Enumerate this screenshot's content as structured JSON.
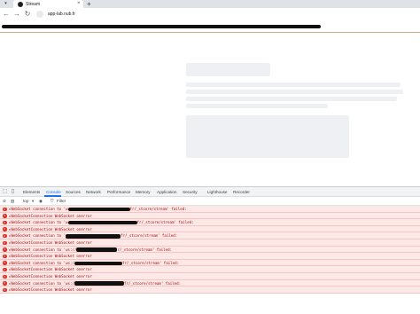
{
  "browser": {
    "tab_title": "Stream",
    "url": "app-lab.nub.fr",
    "new_tab_glyph": "+",
    "close_glyph": "×"
  },
  "devtools": {
    "tabs": [
      "Elements",
      "Console",
      "Sources",
      "Network",
      "Performance",
      "Memory",
      "Application",
      "Security",
      "Lighthouse",
      "Recorder"
    ],
    "active_tab": "Console",
    "console_toolbar": {
      "context": "top",
      "filter_placeholder": "Filter"
    },
    "messages": [
      {
        "prefix": "▸WebSocket connection to 'w",
        "suffix": "fr/_stcore/stream' failed:",
        "redact": 70
      },
      {
        "prefix": "▸WebSocketConnection WebSocket onerror",
        "suffix": "",
        "redact": 0
      },
      {
        "prefix": "▸WebSocket connection to 'w",
        "suffix": "fr/_stcore/stream' failed:",
        "redact": 78
      },
      {
        "prefix": "▸WebSocketConnection WebSocket onerror",
        "suffix": "",
        "redact": 0
      },
      {
        "prefix": "▸WebSocket connection to '",
        "suffix": "fr/_stcore/stream' failed:",
        "redact": 62
      },
      {
        "prefix": "▸WebSocketConnection WebSocket onerror",
        "suffix": "",
        "redact": 0
      },
      {
        "prefix": "▸WebSocket connection to 'ws://",
        "suffix": "r/_stcore/stream' failed:",
        "redact": 46
      },
      {
        "prefix": "▸WebSocketConnection WebSocket onerror",
        "suffix": "",
        "redact": 0
      },
      {
        "prefix": "▸WebSocket connection to 'ws:/",
        "suffix": "fr/_stcore/stream' failed:",
        "redact": 54
      },
      {
        "prefix": "▸WebSocketConnection WebSocket onerror",
        "suffix": "",
        "redact": 0
      },
      {
        "prefix": "▸WebSocketConnection WebSocket onerror",
        "suffix": "",
        "redact": 0
      },
      {
        "prefix": "▸WebSocket connection to 'ws:/",
        "suffix": "fr/_stcore/stream' failed:",
        "redact": 56
      },
      {
        "prefix": "▸WebSocketConnection WebSocket onerror",
        "suffix": "",
        "redact": 0
      }
    ],
    "prompt": ">"
  },
  "colors": {
    "error_bg": "#fce8e6",
    "error_text": "#a50e0e",
    "active_tab": "#1a73e8"
  }
}
